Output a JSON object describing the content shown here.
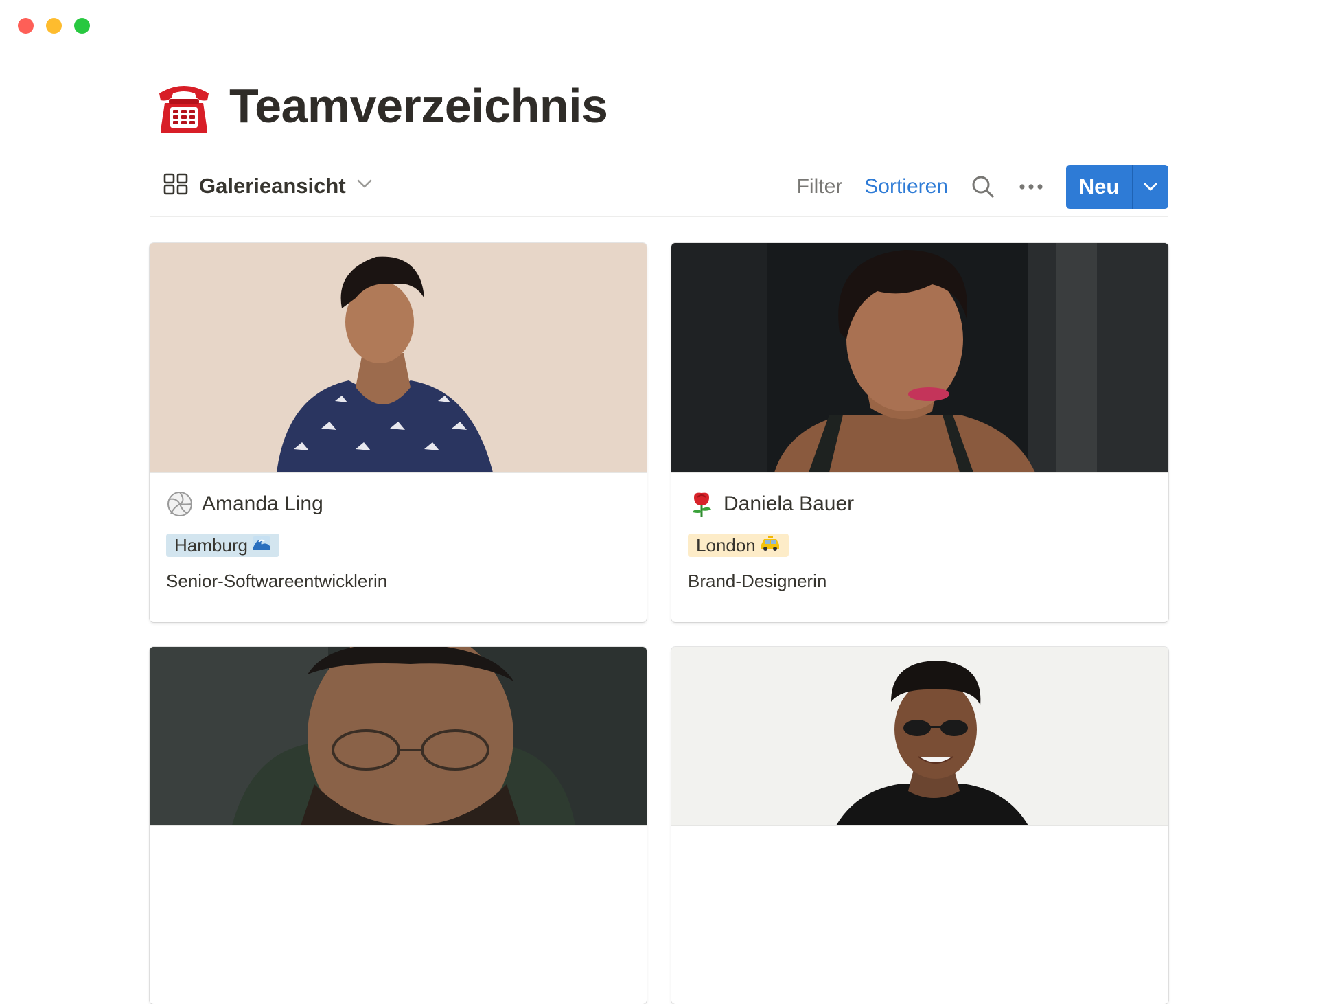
{
  "page": {
    "title": "Teamverzeichnis",
    "title_icon": "telephone-icon"
  },
  "toolbar": {
    "view_label": "Galerieansicht",
    "view_icon": "gallery-grid-icon",
    "filter_label": "Filter",
    "sort_label": "Sortieren",
    "new_label": "Neu"
  },
  "colors": {
    "accent": "#2e7bd6",
    "tag_blue": "#d3e5ef",
    "tag_yellow": "#fdecc8"
  },
  "cards": [
    {
      "name": "Amanda Ling",
      "emoji": "volleyball-icon",
      "location": "Hamburg",
      "location_icon": "wave-icon",
      "role": "Senior-Softwareentwicklerin"
    },
    {
      "name": "Daniela Bauer",
      "emoji": "rose-icon",
      "location": "London",
      "location_icon": "taxi-icon",
      "role": "Brand-Designerin"
    },
    {
      "photo": "man-with-glasses-photo"
    },
    {
      "photo": "smiling-man-sunglasses-photo"
    }
  ]
}
